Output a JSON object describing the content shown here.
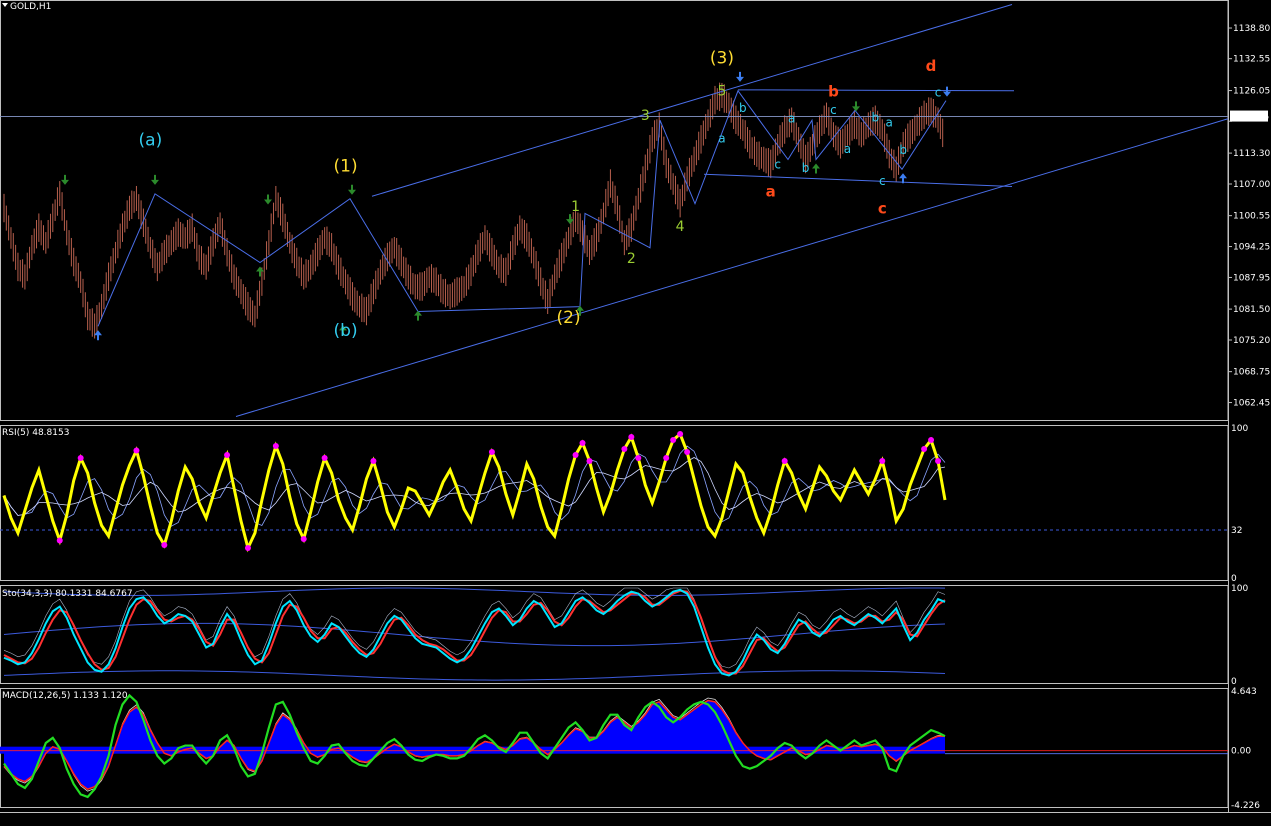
{
  "window": {
    "title": "GOLD,H1"
  },
  "colors": {
    "background": "#000000",
    "panel_border": "#c0c0c0",
    "candle": "#b8604e",
    "channel": "#4a6ee8",
    "wave_path": "#4a6ee8",
    "rsi_line": "#ffff00",
    "rsi_dots": "#ff00ff",
    "stoch_main": "#00e5ff",
    "stoch_signal": "#ff3030",
    "macd_hist": "#0000ff",
    "macd_line": "#22dd22",
    "macd_signal": "#ff2020"
  },
  "chart_data": [
    {
      "type": "line",
      "panel": "price",
      "title": "GOLD,H1",
      "ylim": [
        1059.3,
        1143.9
      ],
      "ticks": [
        1138.8,
        1132.55,
        1126.05,
        1119.8,
        1113.3,
        1107.0,
        1100.55,
        1094.25,
        1087.95,
        1081.5,
        1075.2,
        1068.75,
        1062.45
      ],
      "tick_labels": [
        "1138.80",
        "1132.55",
        "1126.05",
        "1120.75",
        "1113.30",
        "1107.00",
        "1100.55",
        "1094.25",
        "1087.95",
        "1081.50",
        "1075.20",
        "1068.75",
        "1062.45"
      ],
      "current_price": 1120.75,
      "current_price_label": "1120.75",
      "series": [
        {
          "values": [
            1102,
            1096,
            1090,
            1088,
            1094,
            1098,
            1095,
            1100,
            1105,
            1097,
            1091,
            1087,
            1080,
            1078,
            1082,
            1088,
            1093,
            1098,
            1102,
            1104,
            1099,
            1094,
            1090,
            1093,
            1095,
            1097,
            1096,
            1098,
            1092,
            1090,
            1095,
            1099,
            1093,
            1088,
            1085,
            1082,
            1080,
            1087,
            1095,
            1104,
            1100,
            1095,
            1091,
            1088,
            1090,
            1093,
            1096,
            1094,
            1090,
            1087,
            1084,
            1082,
            1081,
            1085,
            1089,
            1092,
            1094,
            1091,
            1088,
            1086,
            1086,
            1088,
            1087,
            1085,
            1084,
            1085,
            1086,
            1089,
            1093,
            1096,
            1093,
            1090,
            1089,
            1094,
            1098,
            1096,
            1092,
            1087,
            1083,
            1088,
            1092,
            1096,
            1100,
            1097,
            1093,
            1096,
            1101,
            1107,
            1102,
            1095,
            1098,
            1104,
            1110,
            1116,
            1119,
            1111,
            1107,
            1103,
            1108,
            1112,
            1116,
            1120,
            1124,
            1125,
            1123,
            1120,
            1118,
            1115,
            1113,
            1112,
            1111,
            1115,
            1118,
            1120,
            1116,
            1112,
            1115,
            1118,
            1121,
            1117,
            1115,
            1117,
            1119,
            1117,
            1119,
            1120,
            1118,
            1113,
            1110,
            1115,
            1117,
            1119,
            1121,
            1122,
            1120,
            1116
          ]
        }
      ]
    },
    {
      "type": "line",
      "panel": "rsi",
      "title": "RSI(5) 48.8153",
      "ylim": [
        0,
        100
      ],
      "tick_labels": [
        "100",
        "32",
        "0"
      ],
      "level": 32,
      "series": [
        {
          "values": [
            55,
            40,
            30,
            45,
            60,
            72,
            55,
            38,
            25,
            42,
            65,
            80,
            70,
            50,
            35,
            28,
            45,
            62,
            75,
            85,
            68,
            48,
            30,
            22,
            38,
            58,
            74,
            66,
            50,
            40,
            55,
            70,
            82,
            60,
            38,
            20,
            30,
            52,
            72,
            88,
            76,
            54,
            36,
            26,
            44,
            64,
            80,
            70,
            52,
            40,
            32,
            48,
            66,
            78,
            62,
            44,
            34,
            46,
            60,
            58,
            50,
            42,
            52,
            64,
            72,
            60,
            46,
            38,
            54,
            70,
            84,
            74,
            56,
            42,
            58,
            76,
            66,
            48,
            34,
            28,
            46,
            66,
            82,
            90,
            78,
            60,
            44,
            56,
            72,
            86,
            94,
            80,
            62,
            50,
            64,
            80,
            92,
            96,
            84,
            66,
            48,
            34,
            28,
            40,
            58,
            76,
            70,
            54,
            40,
            30,
            44,
            62,
            78,
            70,
            56,
            46,
            60,
            74,
            68,
            58,
            52,
            62,
            72,
            64,
            56,
            66,
            78,
            60,
            38,
            46,
            62,
            74,
            86,
            92,
            78,
            52
          ]
        }
      ]
    },
    {
      "type": "line",
      "panel": "stochastic",
      "title": "Sto(34,3,3) 80.1331 84.6767",
      "ylim": [
        0,
        100
      ],
      "tick_labels": [
        "100",
        "0"
      ],
      "series": [
        {
          "values": [
            25,
            22,
            18,
            20,
            30,
            45,
            62,
            75,
            80,
            68,
            50,
            35,
            20,
            12,
            10,
            18,
            35,
            58,
            78,
            88,
            90,
            82,
            70,
            62,
            66,
            72,
            70,
            64,
            50,
            36,
            40,
            58,
            72,
            62,
            44,
            28,
            18,
            22,
            40,
            62,
            80,
            86,
            76,
            60,
            48,
            42,
            50,
            62,
            58,
            48,
            38,
            30,
            26,
            34,
            48,
            62,
            70,
            66,
            56,
            46,
            40,
            38,
            36,
            30,
            24,
            20,
            24,
            34,
            48,
            62,
            74,
            78,
            70,
            60,
            66,
            78,
            86,
            82,
            70,
            58,
            62,
            74,
            86,
            90,
            84,
            76,
            72,
            78,
            86,
            92,
            96,
            94,
            86,
            80,
            84,
            90,
            96,
            98,
            94,
            80,
            58,
            36,
            18,
            8,
            6,
            10,
            22,
            38,
            50,
            44,
            34,
            30,
            40,
            54,
            66,
            62,
            52,
            48,
            56,
            66,
            70,
            64,
            60,
            66,
            72,
            68,
            62,
            70,
            78,
            60,
            44,
            52,
            66,
            76,
            88,
            85
          ]
        },
        {
          "values": [
            28,
            24,
            20,
            19,
            24,
            36,
            52,
            66,
            76,
            74,
            60,
            44,
            30,
            18,
            12,
            14,
            26,
            46,
            66,
            82,
            88,
            86,
            76,
            66,
            64,
            68,
            70,
            66,
            56,
            42,
            38,
            50,
            66,
            66,
            52,
            36,
            24,
            20,
            30,
            50,
            70,
            82,
            80,
            68,
            54,
            46,
            46,
            56,
            58,
            52,
            42,
            34,
            28,
            30,
            40,
            54,
            66,
            68,
            60,
            50,
            44,
            40,
            38,
            34,
            28,
            22,
            22,
            28,
            40,
            54,
            68,
            76,
            74,
            64,
            64,
            72,
            82,
            84,
            76,
            64,
            60,
            68,
            80,
            88,
            86,
            80,
            74,
            76,
            82,
            88,
            94,
            94,
            90,
            82,
            82,
            88,
            94,
            97,
            96,
            86,
            68,
            46,
            26,
            12,
            8,
            8,
            16,
            30,
            44,
            46,
            38,
            32,
            36,
            48,
            60,
            64,
            56,
            50,
            52,
            60,
            68,
            66,
            62,
            64,
            70,
            70,
            64,
            66,
            74,
            66,
            50,
            48,
            60,
            72,
            82,
            87
          ]
        }
      ]
    },
    {
      "type": "bar",
      "panel": "macd",
      "title": "MACD(12,26,5) 1.133 1.120",
      "ylim": [
        -4.226,
        4.643
      ],
      "tick_labels": [
        "4.643",
        "0.00",
        "-4.226"
      ],
      "series": [
        {
          "values": [
            -1.2,
            -1.8,
            -2.2,
            -2.4,
            -2.0,
            -1.2,
            -0.2,
            0.3,
            0.1,
            -0.8,
            -1.8,
            -2.6,
            -3.0,
            -2.8,
            -2.2,
            -1.2,
            0.4,
            2.0,
            3.0,
            3.4,
            2.8,
            1.6,
            0.6,
            -0.2,
            -0.4,
            -0.1,
            0.1,
            0.2,
            -0.2,
            -0.6,
            -0.4,
            0.3,
            0.8,
            0.4,
            -0.6,
            -1.4,
            -1.6,
            -0.8,
            0.6,
            2.0,
            2.8,
            2.4,
            1.6,
            0.6,
            -0.2,
            -0.5,
            -0.3,
            0.1,
            0.2,
            -0.1,
            -0.5,
            -0.8,
            -0.9,
            -0.6,
            -0.2,
            0.2,
            0.5,
            0.3,
            -0.1,
            -0.4,
            -0.5,
            -0.4,
            -0.3,
            -0.3,
            -0.4,
            -0.4,
            -0.3,
            0.0,
            0.4,
            0.7,
            0.6,
            0.3,
            0.1,
            0.4,
            0.9,
            1.0,
            0.6,
            0.1,
            -0.3,
            0.1,
            0.6,
            1.2,
            1.7,
            1.5,
            1.0,
            1.0,
            1.5,
            2.2,
            2.6,
            2.2,
            1.8,
            2.2,
            2.8,
            3.6,
            3.8,
            3.2,
            2.6,
            2.4,
            2.8,
            3.2,
            3.6,
            3.9,
            3.8,
            3.2,
            2.4,
            1.4,
            0.6,
            0.0,
            -0.4,
            -0.6,
            -0.7,
            -0.4,
            -0.1,
            0.2,
            0.0,
            -0.3,
            -0.2,
            0.1,
            0.4,
            0.3,
            0.1,
            0.2,
            0.4,
            0.3,
            0.4,
            0.5,
            0.3,
            -0.4,
            -0.8,
            -0.4,
            0.0,
            0.3,
            0.6,
            0.9,
            1.13,
            1.12
          ]
        },
        {
          "values": [
            -1.0,
            -1.8,
            -2.6,
            -2.9,
            -2.2,
            -0.8,
            0.6,
            1.0,
            0.2,
            -1.4,
            -2.6,
            -3.4,
            -3.6,
            -3.0,
            -2.0,
            -0.4,
            2.0,
            3.6,
            4.3,
            3.8,
            2.4,
            0.8,
            -0.4,
            -1.0,
            -0.6,
            0.2,
            0.4,
            0.4,
            -0.4,
            -1.0,
            -0.4,
            0.8,
            1.2,
            0.2,
            -1.2,
            -2.0,
            -1.8,
            -0.2,
            1.8,
            3.6,
            3.8,
            2.8,
            1.4,
            0.2,
            -0.8,
            -1.0,
            -0.4,
            0.4,
            0.5,
            -0.2,
            -0.8,
            -1.1,
            -1.2,
            -0.6,
            0.0,
            0.6,
            0.9,
            0.4,
            -0.3,
            -0.7,
            -0.8,
            -0.5,
            -0.3,
            -0.4,
            -0.6,
            -0.6,
            -0.4,
            0.2,
            0.9,
            1.2,
            0.8,
            0.2,
            -0.1,
            0.6,
            1.4,
            1.4,
            0.6,
            -0.2,
            -0.6,
            0.2,
            1.0,
            1.8,
            2.2,
            1.6,
            0.8,
            1.0,
            2.0,
            2.8,
            2.8,
            2.0,
            1.6,
            2.6,
            3.4,
            3.8,
            3.4,
            2.6,
            2.2,
            2.6,
            3.2,
            3.6,
            3.8,
            3.6,
            3.0,
            2.0,
            0.8,
            -0.4,
            -1.2,
            -1.4,
            -1.2,
            -0.8,
            -0.4,
            0.2,
            0.6,
            0.4,
            -0.2,
            -0.6,
            -0.2,
            0.4,
            0.8,
            0.4,
            0.0,
            0.4,
            0.8,
            0.4,
            0.6,
            0.8,
            0.2,
            -1.4,
            -1.6,
            -0.4,
            0.4,
            0.8,
            1.2,
            1.6,
            1.4,
            1.133
          ]
        }
      ]
    }
  ],
  "annotations": {
    "primary": [
      {
        "text": "(a)",
        "bar": 21,
        "price": 1114.8,
        "color": "#33ccee"
      },
      {
        "text": "(b)",
        "bar": 49,
        "price": 1076.0,
        "color": "#33ccee"
      },
      {
        "text": "(1)",
        "bar": 49,
        "price": 1109.5,
        "color": "#ffdd33"
      },
      {
        "text": "(2)",
        "bar": 81,
        "price": 1078.7,
        "color": "#ffdd33"
      },
      {
        "text": "(3)",
        "bar": 103,
        "price": 1131.6,
        "color": "#ffdd33"
      }
    ],
    "minor_green": [
      {
        "text": "1",
        "bar": 82,
        "price": 1101.5
      },
      {
        "text": "2",
        "bar": 90,
        "price": 1090.9
      },
      {
        "text": "3",
        "bar": 92,
        "price": 1120.0
      },
      {
        "text": "4",
        "bar": 97,
        "price": 1097.4
      },
      {
        "text": "5",
        "bar": 103,
        "price": 1125.0
      }
    ],
    "red": [
      {
        "text": "a",
        "bar": 110,
        "price": 1104.5
      },
      {
        "text": "b",
        "bar": 119,
        "price": 1124.8
      },
      {
        "text": "c",
        "bar": 126,
        "price": 1101.0
      },
      {
        "text": "d",
        "bar": 133,
        "price": 1130.0
      }
    ],
    "small_cyan": [
      {
        "text": "b",
        "bar": 106,
        "price": 1121.7
      },
      {
        "text": "a",
        "bar": 103,
        "price": 1115.5
      },
      {
        "text": "c",
        "bar": 111,
        "price": 1110.2
      },
      {
        "text": "b",
        "bar": 115,
        "price": 1109.4
      },
      {
        "text": "a",
        "bar": 113,
        "price": 1119.5
      },
      {
        "text": "c",
        "bar": 119,
        "price": 1121.3
      },
      {
        "text": "a",
        "bar": 121,
        "price": 1113.3
      },
      {
        "text": "b",
        "bar": 125,
        "price": 1119.7
      },
      {
        "text": "a",
        "bar": 127,
        "price": 1118.7
      },
      {
        "text": "b",
        "bar": 129,
        "price": 1113.1
      },
      {
        "text": "c",
        "bar": 126,
        "price": 1106.8
      },
      {
        "text": "c",
        "bar": 134,
        "price": 1124.8
      }
    ]
  }
}
